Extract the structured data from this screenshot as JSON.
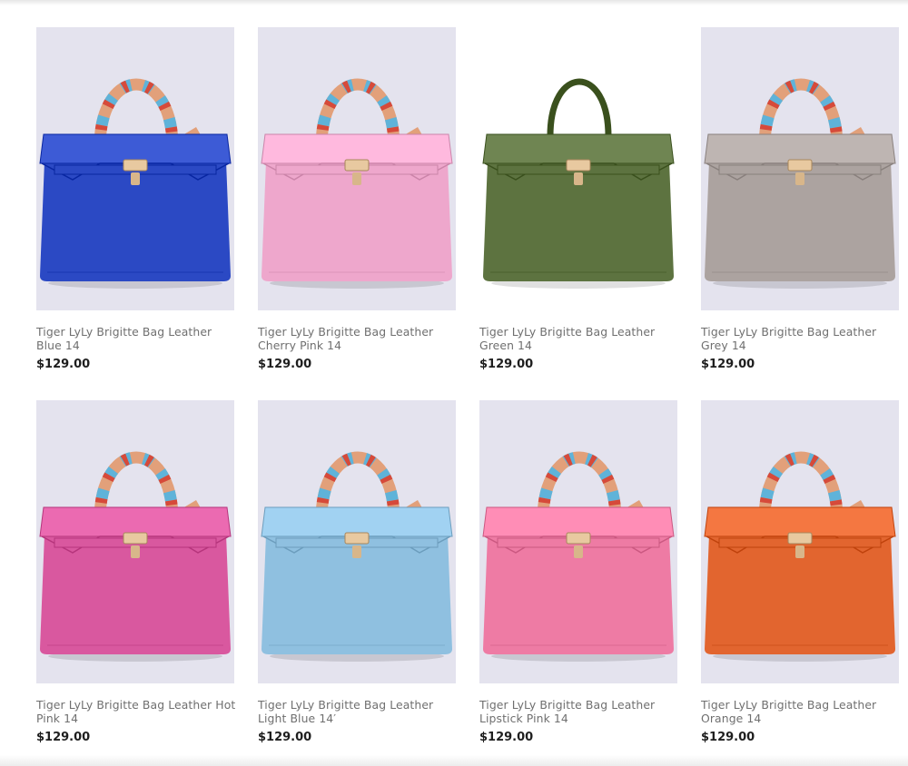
{
  "products": [
    {
      "title": "Tiger LyLy Brigitte Bag Leather Blue 14",
      "price": "$129.00",
      "color": "#2b49c4",
      "scarf": true,
      "bg": "#e4e3ee"
    },
    {
      "title": "Tiger LyLy Brigitte Bag Leather Cherry Pink 14",
      "price": "$129.00",
      "color": "#eea7cc",
      "scarf": true,
      "bg": "#e4e3ee"
    },
    {
      "title": "Tiger LyLy Brigitte Bag Leather Green 14",
      "price": "$129.00",
      "color": "#5d7340",
      "scarf": false,
      "bg": "#ffffff"
    },
    {
      "title": "Tiger LyLy Brigitte Bag Leather Grey 14",
      "price": "$129.00",
      "color": "#aca3a0",
      "scarf": true,
      "bg": "#e4e3ee"
    },
    {
      "title": "Tiger LyLy Brigitte Bag Leather Hot Pink 14",
      "price": "$129.00",
      "color": "#d9589f",
      "scarf": true,
      "bg": "#e4e3ee"
    },
    {
      "title": "Tiger LyLy Brigitte Bag Leather Light Blue 14′",
      "price": "$129.00",
      "color": "#8fc0e0",
      "scarf": true,
      "bg": "#e4e3ee"
    },
    {
      "title": "Tiger LyLy Brigitte Bag Leather Lipstick Pink 14",
      "price": "$129.00",
      "color": "#ee7ba4",
      "scarf": true,
      "bg": "#e4e3ee"
    },
    {
      "title": "Tiger LyLy Brigitte Bag Leather Orange 14",
      "price": "$129.00",
      "color": "#e2652f",
      "scarf": true,
      "bg": "#e4e3ee"
    }
  ]
}
